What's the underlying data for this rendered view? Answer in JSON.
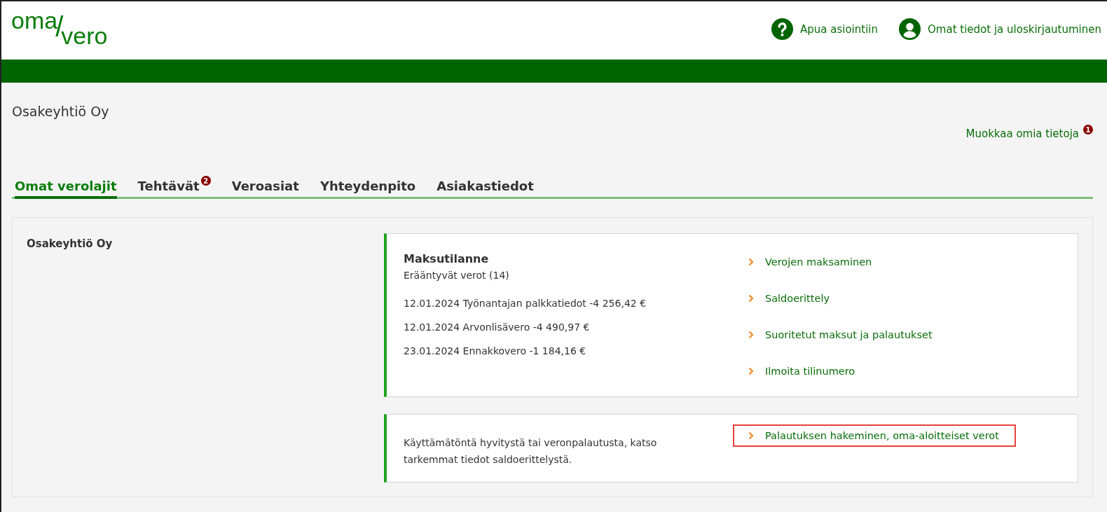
{
  "header": {
    "logo": {
      "top": "oma",
      "slash": "/",
      "bottom": "vero"
    },
    "links": [
      {
        "kind": "help",
        "label": "Apua asiointiin"
      },
      {
        "kind": "user",
        "label": "Omat tiedot ja uloskirjautuminen"
      }
    ]
  },
  "company": {
    "name": "Osakeyhtiö Oy",
    "edit_link": "Muokkaa omia tietoja",
    "edit_badge": "1"
  },
  "tabs": [
    {
      "label": "Omat verolajit",
      "selected": true
    },
    {
      "label": "Tehtävät",
      "selected": false,
      "badge": "2"
    },
    {
      "label": "Veroasiat",
      "selected": false
    },
    {
      "label": "Yhteydenpito",
      "selected": false
    },
    {
      "label": "Asiakastiedot",
      "selected": false
    }
  ],
  "panel": {
    "title": "Osakeyhtiö Oy",
    "cards": [
      {
        "kind": "payments",
        "heading": "Maksutilanne",
        "subheading": "Erääntyvät verot (14)",
        "items": [
          "12.01.2024 Työnantajan palkkatiedot -4 256,42 €",
          "12.01.2024 Arvonlisävero -4 490,97 €",
          "23.01.2024 Ennakkovero -1 184,16 €"
        ],
        "links": [
          {
            "label": "Verojen maksaminen",
            "highlighted": false
          },
          {
            "label": "Saldoerittely",
            "highlighted": false
          },
          {
            "label": "Suoritetut maksut ja palautukset",
            "highlighted": false
          },
          {
            "label": "Ilmoita tilinumero",
            "highlighted": false
          }
        ]
      },
      {
        "kind": "refund",
        "text": "Käyttämätöntä hyvitystä tai veronpalautusta, katso tarkemmat tiedot saldoerittelystä.",
        "links": [
          {
            "label": "Palautuksen hakeminen, oma-aloitteiset verot",
            "highlighted": true
          }
        ]
      }
    ]
  }
}
